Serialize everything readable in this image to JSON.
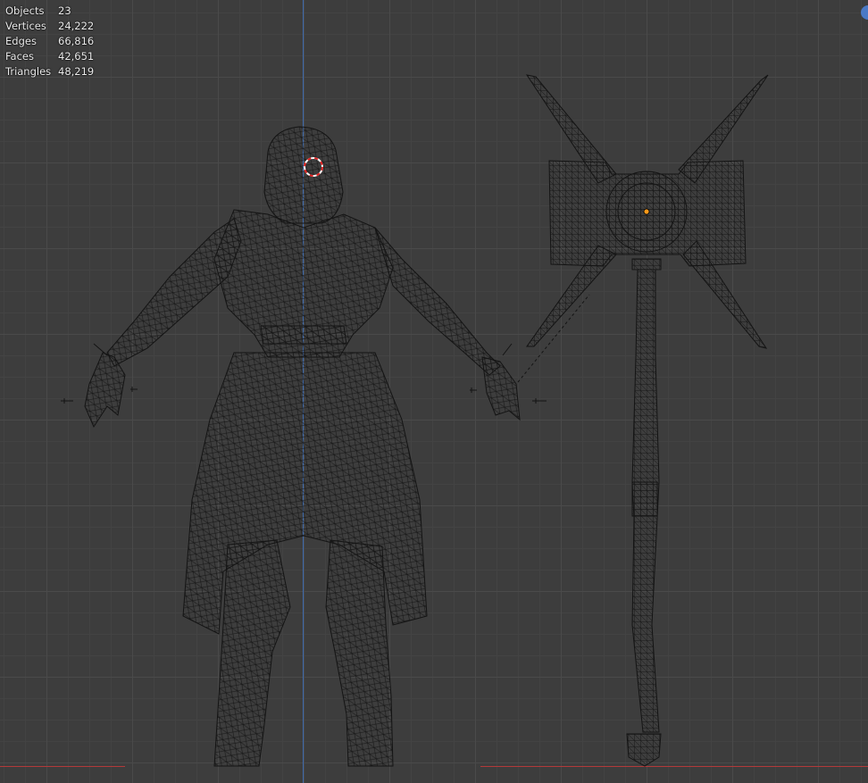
{
  "stats": {
    "rows": [
      {
        "label": "Objects",
        "value": "23"
      },
      {
        "label": "Vertices",
        "value": "24,222"
      },
      {
        "label": "Edges",
        "value": "66,816"
      },
      {
        "label": "Faces",
        "value": "42,651"
      },
      {
        "label": "Triangles",
        "value": "48,219"
      }
    ]
  },
  "icons": {
    "cursor": "3d-cursor-icon",
    "origin": "object-origin-icon",
    "gizmo": "navigation-gizmo-icon"
  },
  "colors": {
    "background": "#3d3d3d",
    "x_axis": "#b23a3a",
    "z_axis": "#3f6fb8",
    "wire": "#121212",
    "origin": "#ff9a1a",
    "cursor_red": "#e02020"
  }
}
